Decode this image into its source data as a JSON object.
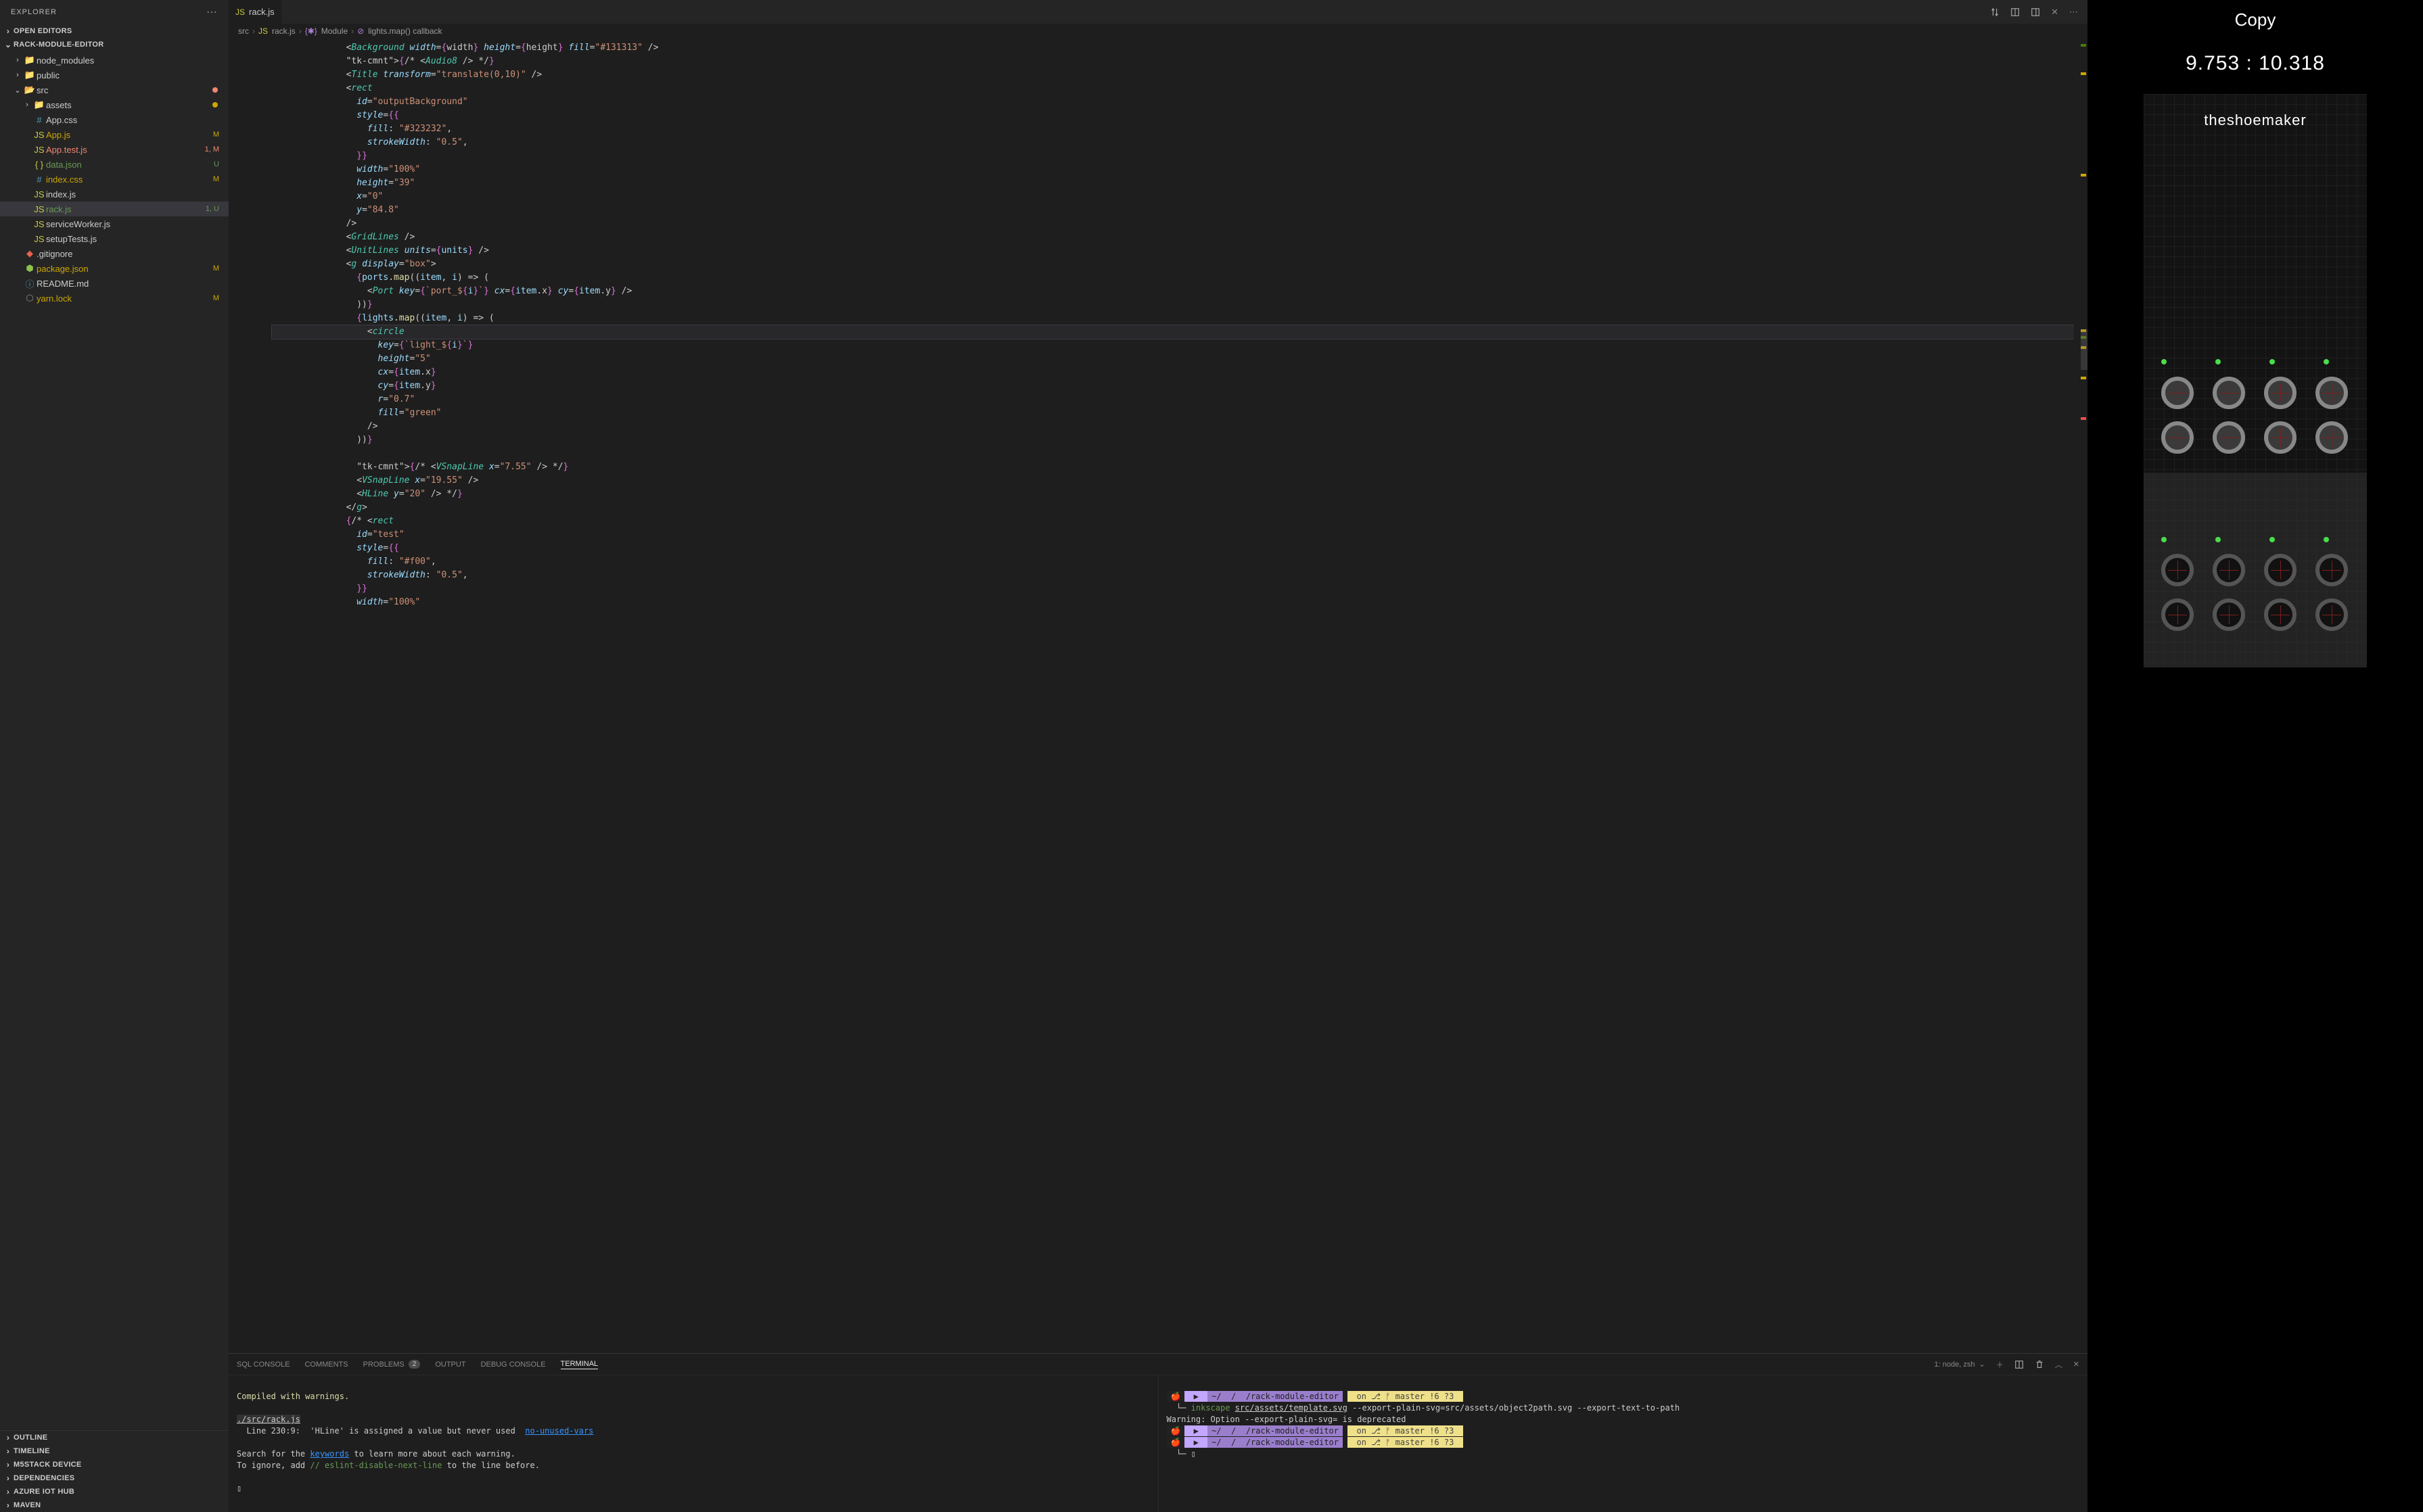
{
  "sidebar": {
    "title": "EXPLORER",
    "sections": {
      "openEditors": "OPEN EDITORS",
      "project": "RACK-MODULE-EDITOR",
      "outline": "OUTLINE",
      "timeline": "TIMELINE",
      "m5stack": "M5STACK DEVICE",
      "deps": "DEPENDENCIES",
      "azure": "AZURE IOT HUB",
      "maven": "MAVEN"
    },
    "tree": [
      {
        "label": "node_modules",
        "type": "folder",
        "indent": 1,
        "chev": "›"
      },
      {
        "label": "public",
        "type": "folder",
        "indent": 1,
        "chev": "›"
      },
      {
        "label": "src",
        "type": "folder-open",
        "indent": 1,
        "chev": "⌄",
        "dot": "red"
      },
      {
        "label": "assets",
        "type": "folder",
        "indent": 2,
        "chev": "›",
        "dot": "amber"
      },
      {
        "label": "App.css",
        "type": "css",
        "indent": 2
      },
      {
        "label": "App.js",
        "type": "js",
        "indent": 2,
        "badge": "M",
        "badgeColor": "#cca700"
      },
      {
        "label": "App.test.js",
        "type": "js",
        "indent": 2,
        "badge": "1, M",
        "badgeColor": "#f48771"
      },
      {
        "label": "data.json",
        "type": "jsonb",
        "indent": 2,
        "badge": "U",
        "badgeColor": "#6a9955"
      },
      {
        "label": "index.css",
        "type": "css",
        "indent": 2,
        "badge": "M",
        "badgeColor": "#cca700"
      },
      {
        "label": "index.js",
        "type": "js",
        "indent": 2
      },
      {
        "label": "rack.js",
        "type": "js",
        "indent": 2,
        "badge": "1, U",
        "badgeColor": "#6a9955",
        "selected": true
      },
      {
        "label": "serviceWorker.js",
        "type": "js",
        "indent": 2
      },
      {
        "label": "setupTests.js",
        "type": "js",
        "indent": 2
      },
      {
        "label": ".gitignore",
        "type": "git",
        "indent": 1
      },
      {
        "label": "package.json",
        "type": "jsong",
        "indent": 1,
        "badge": "M",
        "badgeColor": "#cca700"
      },
      {
        "label": "README.md",
        "type": "md",
        "indent": 1
      },
      {
        "label": "yarn.lock",
        "type": "lock",
        "indent": 1,
        "badge": "M",
        "badgeColor": "#cca700"
      }
    ]
  },
  "tab": {
    "icon": "JS",
    "label": "rack.js"
  },
  "breadcrumb": {
    "p0": "src",
    "p1": "rack.js",
    "p2": "Module",
    "p3": "lights.map() callback"
  },
  "code": {
    "lines": [
      "<Background width={width} height={height} fill=\"#131313\" />",
      "{/* <Audio8 /> */}",
      "<Title transform=\"translate(0,10)\" />",
      "<rect",
      "  id=\"outputBackground\"",
      "  style={{",
      "    fill: \"#323232\",",
      "    strokeWidth: \"0.5\",",
      "  }}",
      "  width=\"100%\"",
      "  height=\"39\"",
      "  x=\"0\"",
      "  y=\"84.8\"",
      "/>",
      "<GridLines />",
      "<UnitLines units={units} />",
      "<g display=\"box\">",
      "  {ports.map((item, i) => (",
      "    <Port key={`port_${i}`} cx={item.x} cy={item.y} />",
      "  ))}",
      "  {lights.map((item, i) => (",
      "    <circle",
      "      key={`light_${i}`}",
      "      height=\"5\"",
      "      cx={item.x}",
      "      cy={item.y}",
      "      r=\"0.7\"",
      "      fill=\"green\"",
      "    />",
      "  ))}",
      "",
      "  {/* <VSnapLine x=\"7.55\" /> */}",
      "  <VSnapLine x=\"19.55\" />",
      "  <HLine y=\"20\" /> */}",
      "</g>",
      "{/* <rect",
      "  id=\"test\"",
      "  style={{",
      "    fill: \"#f00\",",
      "    strokeWidth: \"0.5\",",
      "  }}",
      "  width=\"100%\""
    ],
    "hlIndex": 21
  },
  "panel": {
    "tabs": {
      "sql": "SQL CONSOLE",
      "comments": "COMMENTS",
      "problems": "PROBLEMS",
      "problemsCount": "2",
      "output": "OUTPUT",
      "debug": "DEBUG CONSOLE",
      "terminal": "TERMINAL"
    },
    "terminalSelector": "1: node, zsh",
    "console": {
      "l1": "Compiled with warnings.",
      "l2": "./src/rack.js",
      "l3": "  Line 230:9:  'HLine' is assigned a value but never used  ",
      "l4": "no-unused-vars",
      "l5": "Search for the ",
      "l5a": "keywords",
      "l5b": " to learn more about each warning.",
      "l6": "To ignore, add ",
      "l6a": "// eslint-disable-next-line",
      "l6b": " to the line before.",
      "cursor": "▯"
    },
    "terminal": {
      "prompt_path": "~/   /   /rack-module-editor",
      "prompt_branch": " on ⎇ ᚠ master !6 ?3 ",
      "cmd": "inkscape ",
      "cmd_arg": "src/assets/template.svg",
      "cmd_rest": " --export-plain-svg=src/assets/object2path.svg --export-text-to-path",
      "warn": "Warning: Option --export-plain-svg= is deprecated",
      "cursor": "▯"
    }
  },
  "preview": {
    "title": "Copy",
    "coords": "9.753 : 10.318",
    "brand": "theshoemaker"
  }
}
